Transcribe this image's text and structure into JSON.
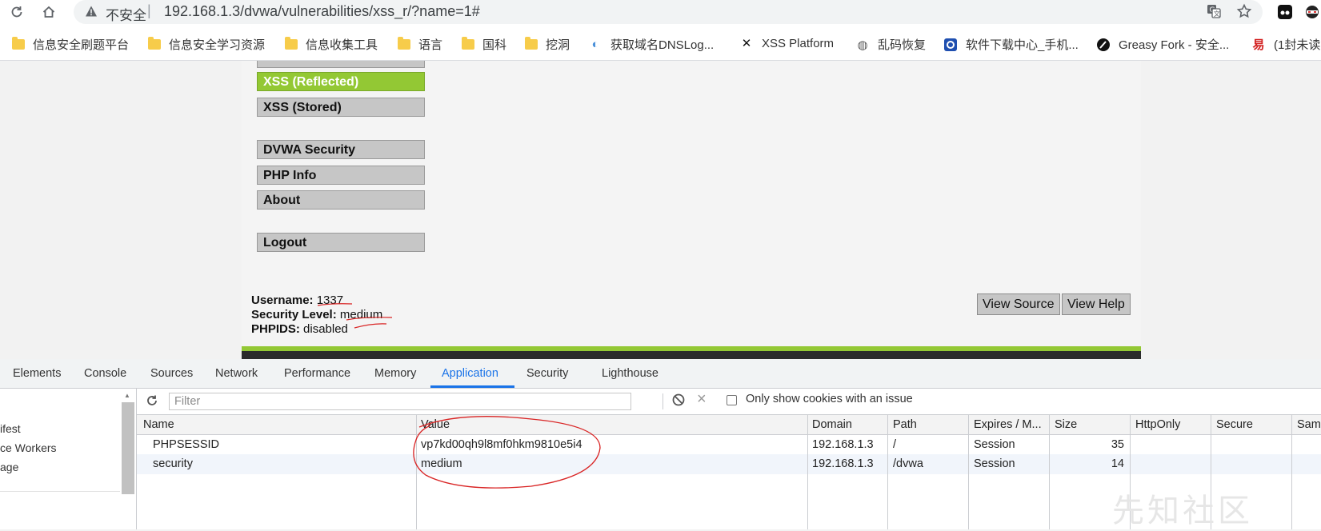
{
  "browser": {
    "insecure_label": "不安全",
    "url": "192.168.1.3/dvwa/vulnerabilities/xss_r/?name=1#",
    "bookmarks": [
      {
        "label": "信息安全刷题平台",
        "icon": "folder-icon"
      },
      {
        "label": "信息安全学习资源",
        "icon": "folder-icon"
      },
      {
        "label": "信息收集工具",
        "icon": "folder-icon"
      },
      {
        "label": "语言",
        "icon": "folder-icon"
      },
      {
        "label": "国科",
        "icon": "folder-icon"
      },
      {
        "label": "挖洞",
        "icon": "folder-icon"
      },
      {
        "label": "获取域名DNSLog...",
        "icon": "dnslog-icon"
      },
      {
        "label": "XSS Platform",
        "icon": "xss-icon"
      },
      {
        "label": "乱码恢复",
        "icon": "globe-icon"
      },
      {
        "label": "软件下载中心_手机...",
        "icon": "download-icon"
      },
      {
        "label": "Greasy Fork - 安全...",
        "icon": "greasyfork-icon"
      },
      {
        "label": "(1封未读",
        "icon": "mail-icon"
      }
    ]
  },
  "dvwa": {
    "menu": [
      {
        "label": "XSS (Reflected)",
        "active": true
      },
      {
        "label": "XSS (Stored)",
        "active": false
      },
      {
        "label": "DVWA Security",
        "active": false
      },
      {
        "label": "PHP Info",
        "active": false
      },
      {
        "label": "About",
        "active": false
      },
      {
        "label": "Logout",
        "active": false
      }
    ],
    "username_label": "Username:",
    "username_value": "1337",
    "security_label": "Security Level:",
    "security_value": "medium",
    "phpids_label": "PHPIDS:",
    "phpids_value": "disabled",
    "view_source": "View Source",
    "view_help": "View Help"
  },
  "devtools": {
    "tabs": [
      "Elements",
      "Console",
      "Sources",
      "Network",
      "Performance",
      "Memory",
      "Application",
      "Security",
      "Lighthouse"
    ],
    "active_tab": "Application",
    "sidebar_items": [
      "ifest",
      "ce Workers",
      "age"
    ],
    "filter_placeholder": "Filter",
    "only_issue_label": "Only show cookies with an issue",
    "columns": [
      "Name",
      "Value",
      "Domain",
      "Path",
      "Expires / M...",
      "Size",
      "HttpOnly",
      "Secure",
      "Sam"
    ],
    "rows": [
      {
        "name": "PHPSESSID",
        "value": "vp7kd00qh9l8mf0hkm9810e5i4",
        "domain": "192.168.1.3",
        "path": "/",
        "expires": "Session",
        "size": "35"
      },
      {
        "name": "security",
        "value": "medium",
        "domain": "192.168.1.3",
        "path": "/dvwa",
        "expires": "Session",
        "size": "14"
      }
    ],
    "accent_color": "#1a73e8"
  },
  "watermark": "先知社区"
}
